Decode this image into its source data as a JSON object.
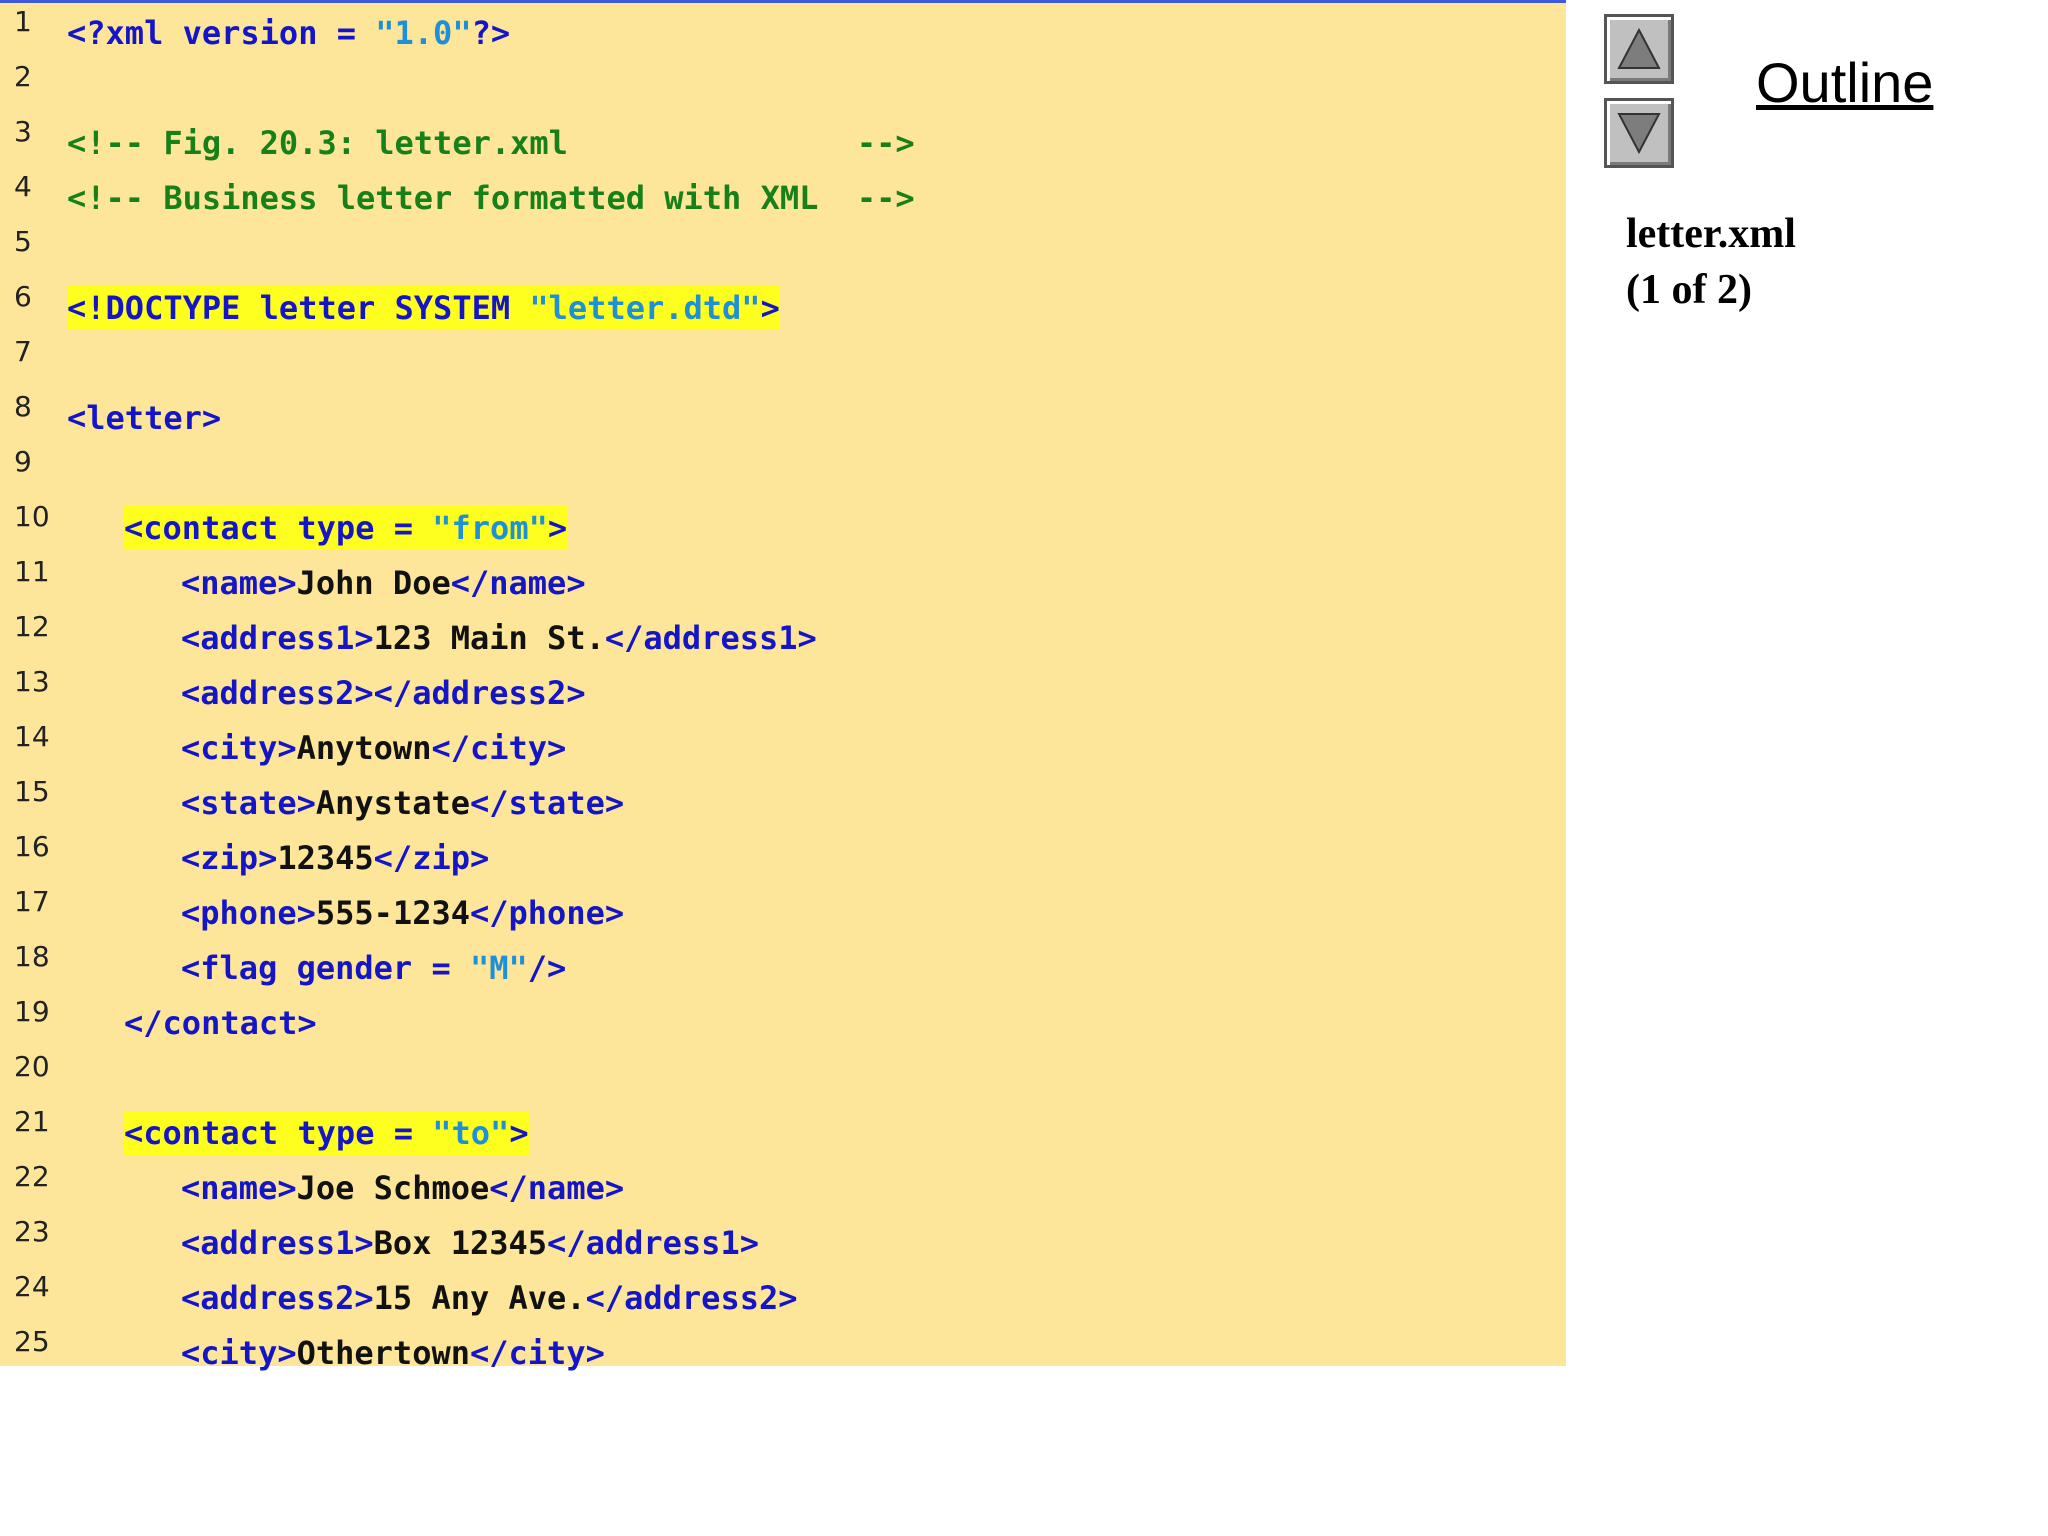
{
  "outline": {
    "title": "Outline",
    "file_name": "letter.xml",
    "page_indicator": "(1 of 2)",
    "up_button_icon": "triangle-up-icon",
    "down_button_icon": "triangle-down-icon"
  },
  "colors": {
    "panel_background": "#fde69a",
    "tag": "#1515c8",
    "string": "#1e90d8",
    "comment": "#188018",
    "text": "#111111",
    "highlight": "#ffff1f"
  },
  "code_lines": [
    {
      "num": "1",
      "indent": 0,
      "highlight": false,
      "segments": [
        {
          "t": "tag",
          "s": "<?xml version = "
        },
        {
          "t": "str",
          "s": "\"1.0\""
        },
        {
          "t": "tag",
          "s": "?>"
        }
      ]
    },
    {
      "num": "2",
      "indent": 0,
      "highlight": false,
      "segments": []
    },
    {
      "num": "3",
      "indent": 0,
      "highlight": false,
      "segments": [
        {
          "t": "cmt",
          "s": "<!-- Fig. 20.3: letter.xml               -->"
        }
      ]
    },
    {
      "num": "4",
      "indent": 0,
      "highlight": false,
      "segments": [
        {
          "t": "cmt",
          "s": "<!-- Business letter formatted with XML  -->"
        }
      ]
    },
    {
      "num": "5",
      "indent": 0,
      "highlight": false,
      "segments": []
    },
    {
      "num": "6",
      "indent": 0,
      "highlight": true,
      "segments": [
        {
          "t": "tag",
          "s": "<!DOCTYPE letter SYSTEM "
        },
        {
          "t": "str",
          "s": "\"letter.dtd\""
        },
        {
          "t": "tag",
          "s": ">"
        }
      ]
    },
    {
      "num": "7",
      "indent": 0,
      "highlight": false,
      "segments": []
    },
    {
      "num": "8",
      "indent": 0,
      "highlight": false,
      "segments": [
        {
          "t": "tag",
          "s": "<letter>"
        }
      ]
    },
    {
      "num": "9",
      "indent": 0,
      "highlight": false,
      "segments": []
    },
    {
      "num": "10",
      "indent": 1,
      "highlight": true,
      "segments": [
        {
          "t": "tag",
          "s": "<contact type = "
        },
        {
          "t": "str",
          "s": "\"from\""
        },
        {
          "t": "tag",
          "s": ">"
        }
      ]
    },
    {
      "num": "11",
      "indent": 2,
      "highlight": false,
      "segments": [
        {
          "t": "tag",
          "s": "<name>"
        },
        {
          "t": "txt",
          "s": "John Doe"
        },
        {
          "t": "tag",
          "s": "</name>"
        }
      ]
    },
    {
      "num": "12",
      "indent": 2,
      "highlight": false,
      "segments": [
        {
          "t": "tag",
          "s": "<address1>"
        },
        {
          "t": "txt",
          "s": "123 Main St."
        },
        {
          "t": "tag",
          "s": "</address1>"
        }
      ]
    },
    {
      "num": "13",
      "indent": 2,
      "highlight": false,
      "segments": [
        {
          "t": "tag",
          "s": "<address2></address2>"
        }
      ]
    },
    {
      "num": "14",
      "indent": 2,
      "highlight": false,
      "segments": [
        {
          "t": "tag",
          "s": "<city>"
        },
        {
          "t": "txt",
          "s": "Anytown"
        },
        {
          "t": "tag",
          "s": "</city>"
        }
      ]
    },
    {
      "num": "15",
      "indent": 2,
      "highlight": false,
      "segments": [
        {
          "t": "tag",
          "s": "<state>"
        },
        {
          "t": "txt",
          "s": "Anystate"
        },
        {
          "t": "tag",
          "s": "</state>"
        }
      ]
    },
    {
      "num": "16",
      "indent": 2,
      "highlight": false,
      "segments": [
        {
          "t": "tag",
          "s": "<zip>"
        },
        {
          "t": "txt",
          "s": "12345"
        },
        {
          "t": "tag",
          "s": "</zip>"
        }
      ]
    },
    {
      "num": "17",
      "indent": 2,
      "highlight": false,
      "segments": [
        {
          "t": "tag",
          "s": "<phone>"
        },
        {
          "t": "txt",
          "s": "555-1234"
        },
        {
          "t": "tag",
          "s": "</phone>"
        }
      ]
    },
    {
      "num": "18",
      "indent": 2,
      "highlight": false,
      "segments": [
        {
          "t": "tag",
          "s": "<flag gender = "
        },
        {
          "t": "str",
          "s": "\"M\""
        },
        {
          "t": "tag",
          "s": "/>"
        }
      ]
    },
    {
      "num": "19",
      "indent": 1,
      "highlight": false,
      "segments": [
        {
          "t": "tag",
          "s": "</contact>"
        }
      ]
    },
    {
      "num": "20",
      "indent": 0,
      "highlight": false,
      "segments": []
    },
    {
      "num": "21",
      "indent": 1,
      "highlight": true,
      "segments": [
        {
          "t": "tag",
          "s": "<contact type = "
        },
        {
          "t": "str",
          "s": "\"to\""
        },
        {
          "t": "tag",
          "s": ">"
        }
      ]
    },
    {
      "num": "22",
      "indent": 2,
      "highlight": false,
      "segments": [
        {
          "t": "tag",
          "s": "<name>"
        },
        {
          "t": "txt",
          "s": "Joe Schmoe"
        },
        {
          "t": "tag",
          "s": "</name>"
        }
      ]
    },
    {
      "num": "23",
      "indent": 2,
      "highlight": false,
      "segments": [
        {
          "t": "tag",
          "s": "<address1>"
        },
        {
          "t": "txt",
          "s": "Box 12345"
        },
        {
          "t": "tag",
          "s": "</address1>"
        }
      ]
    },
    {
      "num": "24",
      "indent": 2,
      "highlight": false,
      "segments": [
        {
          "t": "tag",
          "s": "<address2>"
        },
        {
          "t": "txt",
          "s": "15 Any Ave."
        },
        {
          "t": "tag",
          "s": "</address2>"
        }
      ]
    },
    {
      "num": "25",
      "indent": 2,
      "highlight": false,
      "segments": [
        {
          "t": "tag",
          "s": "<city>"
        },
        {
          "t": "txt",
          "s": "Othertown"
        },
        {
          "t": "tag",
          "s": "</city>"
        }
      ]
    }
  ]
}
